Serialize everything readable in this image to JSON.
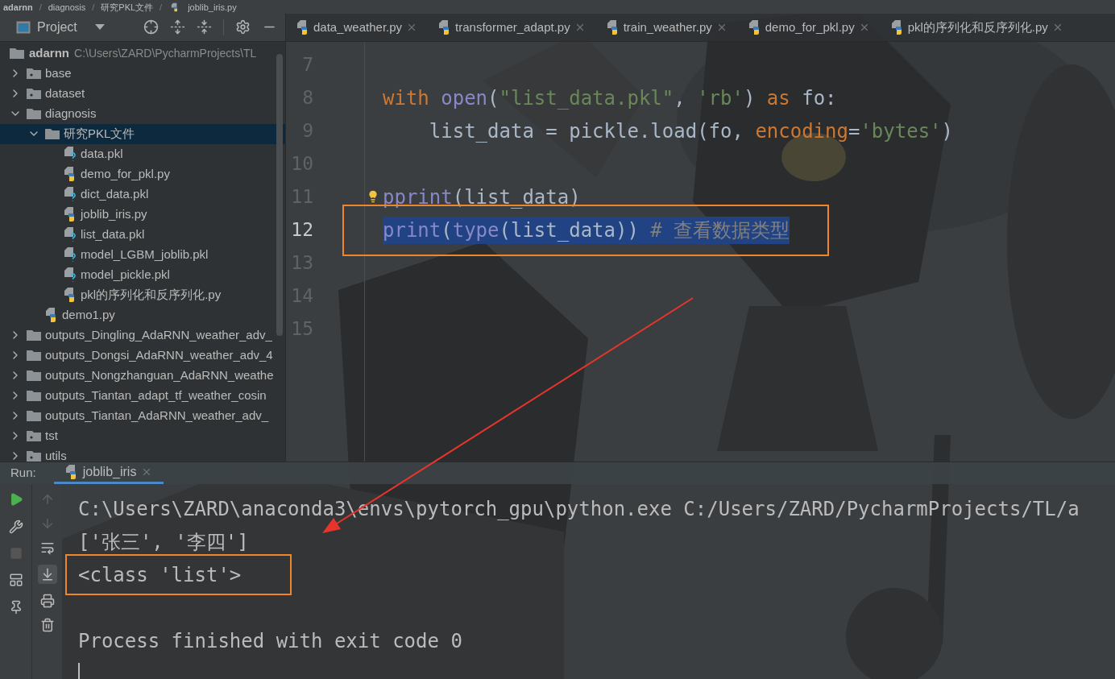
{
  "breadcrumb": {
    "separator": "/",
    "items": [
      {
        "label": "adarnn",
        "kind": "folder"
      },
      {
        "label": "diagnosis",
        "kind": "folder"
      },
      {
        "label": "研究PKL文件",
        "kind": "folder"
      },
      {
        "label": "joblib_iris.py",
        "kind": "py"
      }
    ]
  },
  "project_panel": {
    "title": "Project",
    "root": {
      "name": "adarnn",
      "path": "C:\\Users\\ZARD\\PycharmProjects\\TL",
      "children": [
        {
          "name": "base",
          "kind": "package",
          "expanded": false,
          "selected": false
        },
        {
          "name": "dataset",
          "kind": "package",
          "expanded": false,
          "selected": false
        },
        {
          "name": "diagnosis",
          "kind": "folder",
          "expanded": true,
          "selected": false,
          "children": [
            {
              "name": "研究PKL文件",
              "kind": "folder",
              "expanded": true,
              "selected": true,
              "children": [
                {
                  "name": "data.pkl",
                  "kind": "unknown",
                  "selected": false
                },
                {
                  "name": "demo_for_pkl.py",
                  "kind": "py",
                  "selected": false
                },
                {
                  "name": "dict_data.pkl",
                  "kind": "unknown",
                  "selected": false
                },
                {
                  "name": "joblib_iris.py",
                  "kind": "py",
                  "selected": false
                },
                {
                  "name": "list_data.pkl",
                  "kind": "unknown",
                  "selected": false
                },
                {
                  "name": "model_LGBM_joblib.pkl",
                  "kind": "unknown",
                  "selected": false
                },
                {
                  "name": "model_pickle.pkl",
                  "kind": "unknown",
                  "selected": false
                },
                {
                  "name": "pkl的序列化和反序列化.py",
                  "kind": "py",
                  "selected": false
                }
              ]
            },
            {
              "name": "demo1.py",
              "kind": "py",
              "selected": false
            }
          ]
        },
        {
          "name": "outputs_Dingling_AdaRNN_weather_adv_",
          "kind": "folder",
          "expanded": false,
          "selected": false
        },
        {
          "name": "outputs_Dongsi_AdaRNN_weather_adv_4",
          "kind": "folder",
          "expanded": false,
          "selected": false
        },
        {
          "name": "outputs_Nongzhanguan_AdaRNN_weathe",
          "kind": "folder",
          "expanded": false,
          "selected": false
        },
        {
          "name": "outputs_Tiantan_adapt_tf_weather_cosin",
          "kind": "folder",
          "expanded": false,
          "selected": false
        },
        {
          "name": "outputs_Tiantan_AdaRNN_weather_adv_",
          "kind": "folder",
          "expanded": false,
          "selected": false
        },
        {
          "name": "tst",
          "kind": "package",
          "expanded": false,
          "selected": false
        },
        {
          "name": "utils",
          "kind": "package",
          "expanded": false,
          "selected": false
        }
      ]
    }
  },
  "editor": {
    "tabs": [
      {
        "label": "data_weather.py"
      },
      {
        "label": "transformer_adapt.py"
      },
      {
        "label": "train_weather.py"
      },
      {
        "label": "demo_for_pkl.py"
      },
      {
        "label": "pkl的序列化和反序列化.py"
      }
    ],
    "lines": [
      {
        "number": "7",
        "selected": false,
        "bulb": false
      },
      {
        "number": "8",
        "selected": false,
        "bulb": false,
        "tokens": [
          {
            "kind": "keyword",
            "text": "with "
          },
          {
            "kind": "builtin",
            "text": "open"
          },
          {
            "kind": "plain",
            "text": "("
          },
          {
            "kind": "string",
            "text": "\"list_data.pkl\""
          },
          {
            "kind": "plain",
            "text": ", "
          },
          {
            "kind": "string",
            "text": "'rb'"
          },
          {
            "kind": "plain",
            "text": ") "
          },
          {
            "kind": "keyword",
            "text": "as"
          },
          {
            "kind": "plain",
            "text": " fo:"
          }
        ]
      },
      {
        "number": "9",
        "selected": false,
        "bulb": false,
        "tokens": [
          {
            "kind": "plain",
            "text": "    list_data = pickle.load(fo, "
          },
          {
            "kind": "param",
            "text": "encoding"
          },
          {
            "kind": "plain",
            "text": "="
          },
          {
            "kind": "string",
            "text": "'bytes'"
          },
          {
            "kind": "plain",
            "text": ")"
          }
        ]
      },
      {
        "number": "10",
        "selected": false,
        "bulb": false
      },
      {
        "number": "11",
        "selected": false,
        "bulb": true,
        "tokens": [
          {
            "kind": "builtin",
            "text": "pprint"
          },
          {
            "kind": "plain",
            "text": "(list_data)"
          }
        ]
      },
      {
        "number": "12",
        "selected": true,
        "bulb": false,
        "tokens": [
          {
            "kind": "builtin",
            "text": "print"
          },
          {
            "kind": "plain",
            "text": "("
          },
          {
            "kind": "builtin",
            "text": "type"
          },
          {
            "kind": "plain",
            "text": "(list_data))"
          },
          {
            "kind": "comment",
            "text": " # 查看数据类型"
          }
        ]
      },
      {
        "number": "13",
        "selected": false,
        "bulb": false
      },
      {
        "number": "14",
        "selected": false,
        "bulb": false
      },
      {
        "number": "15",
        "selected": false,
        "bulb": false
      }
    ]
  },
  "run_panel": {
    "label": "Run:",
    "tab": {
      "label": "joblib_iris",
      "selected": true
    },
    "console": [
      {
        "kind": "output",
        "highlighted": false,
        "text": "C:\\Users\\ZARD\\anaconda3\\envs\\pytorch_gpu\\python.exe C:/Users/ZARD/PycharmProjects/TL/a"
      },
      {
        "kind": "output",
        "highlighted": false,
        "text": "['张三', '李四']"
      },
      {
        "kind": "output",
        "highlighted": true,
        "text": "<class 'list'>"
      },
      {
        "kind": "blank"
      },
      {
        "kind": "output",
        "highlighted": false,
        "text": "Process finished with exit code 0"
      },
      {
        "kind": "cursor"
      }
    ]
  }
}
